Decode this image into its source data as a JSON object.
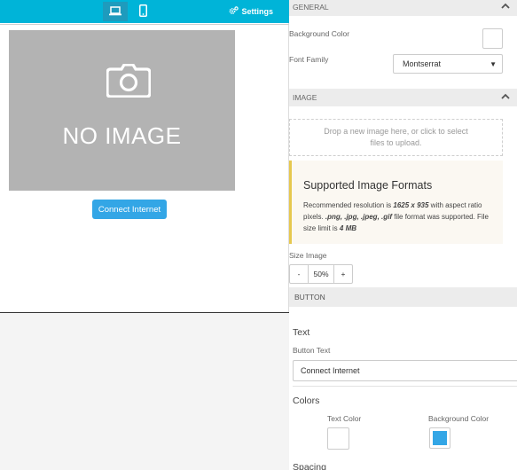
{
  "toolbar": {
    "settings_label": "Settings",
    "accent": "#00b4d8"
  },
  "preview": {
    "placeholder_text": "NO IMAGE",
    "cta_label": "Connect Internet",
    "cta_color": "#33a6e6"
  },
  "general": {
    "heading": "GENERAL",
    "background_color_label": "Background Color",
    "font_family_label": "Font Family",
    "font_family_value": "Montserrat"
  },
  "image": {
    "heading": "IMAGE",
    "dropzone_line1": "Drop a new image here, or click to select",
    "dropzone_line2": "files to upload.",
    "notice_title": "Supported Image Formats",
    "notice_pre": "Recommended resolution is ",
    "notice_resolution": "1625 x 935",
    "notice_mid": " with aspect ratio pixels. ",
    "notice_formats": ".png, .jpg, .jpeg, .gif",
    "notice_mid2": " file format was supported. File size limit is ",
    "notice_limit": "4 MB",
    "size_label": "Size Image",
    "size_minus": "-",
    "size_value": "50%",
    "size_plus": "+"
  },
  "button": {
    "heading": "BUTTON",
    "text_section": "Text",
    "button_text_label": "Button Text",
    "button_text_value": "Connect Internet",
    "colors_section": "Colors",
    "text_color_label": "Text Color",
    "text_color_value": "#ffffff",
    "bg_color_label": "Background Color",
    "bg_color_value": "#33a6e6",
    "spacing_section": "Spacing"
  },
  "icons": {
    "desktop": "laptop-icon",
    "mobile": "mobile-icon",
    "settings": "gears-icon",
    "camera": "camera-icon",
    "collapse": "chevron-up-icon",
    "dropdown": "caret-down-icon"
  }
}
